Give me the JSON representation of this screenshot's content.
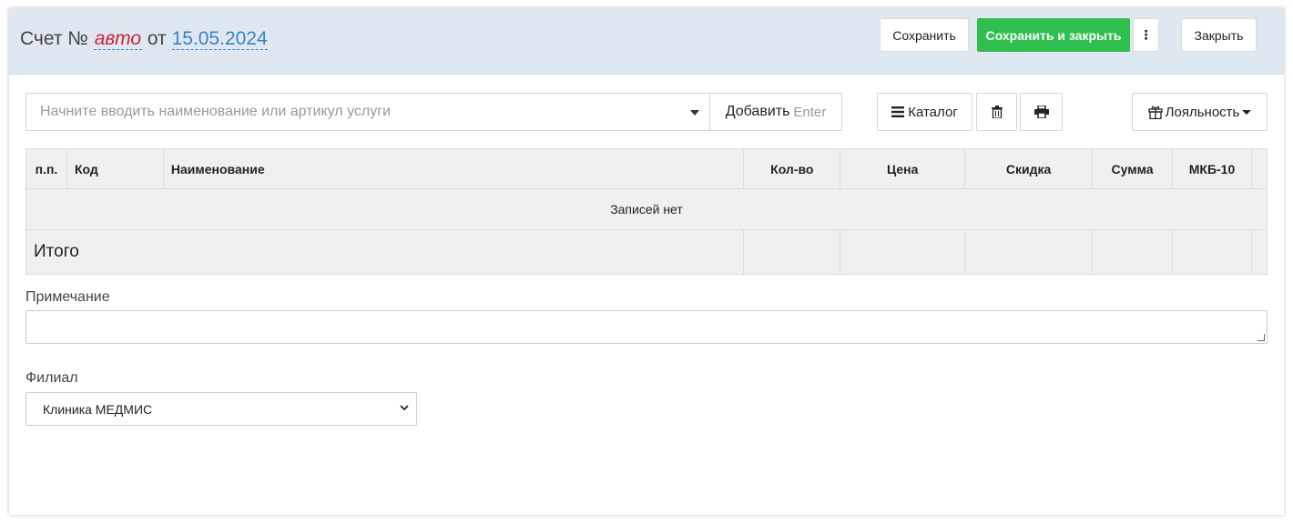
{
  "header": {
    "title_prefix": "Счет №",
    "number": "авто",
    "date_sep": "от",
    "date": "15.05.2024",
    "save_label": "Сохранить",
    "save_close_label": "Сохранить и закрыть",
    "more_label": "⋮",
    "close_label": "Закрыть"
  },
  "toolbar": {
    "search_placeholder": "Начните вводить наименование или артикул услуги",
    "add_label": "Добавить",
    "add_hint": "Enter",
    "catalog_label": "Каталог",
    "loyalty_label": "Лояльность"
  },
  "table": {
    "columns": [
      "п.п.",
      "Код",
      "Наименование",
      "Кол-во",
      "Цена",
      "Скидка",
      "Сумма",
      "МКБ-10"
    ],
    "empty_text": "Записей нет",
    "total_label": "Итого"
  },
  "note": {
    "label": "Примечание",
    "value": ""
  },
  "branch": {
    "label": "Филиал",
    "value": "Клиника МЕДМИС"
  },
  "colors": {
    "accent": "#2fbf4f",
    "header_bg": "#dfe8f0",
    "number": "#d0213b",
    "link": "#3a82c4"
  }
}
